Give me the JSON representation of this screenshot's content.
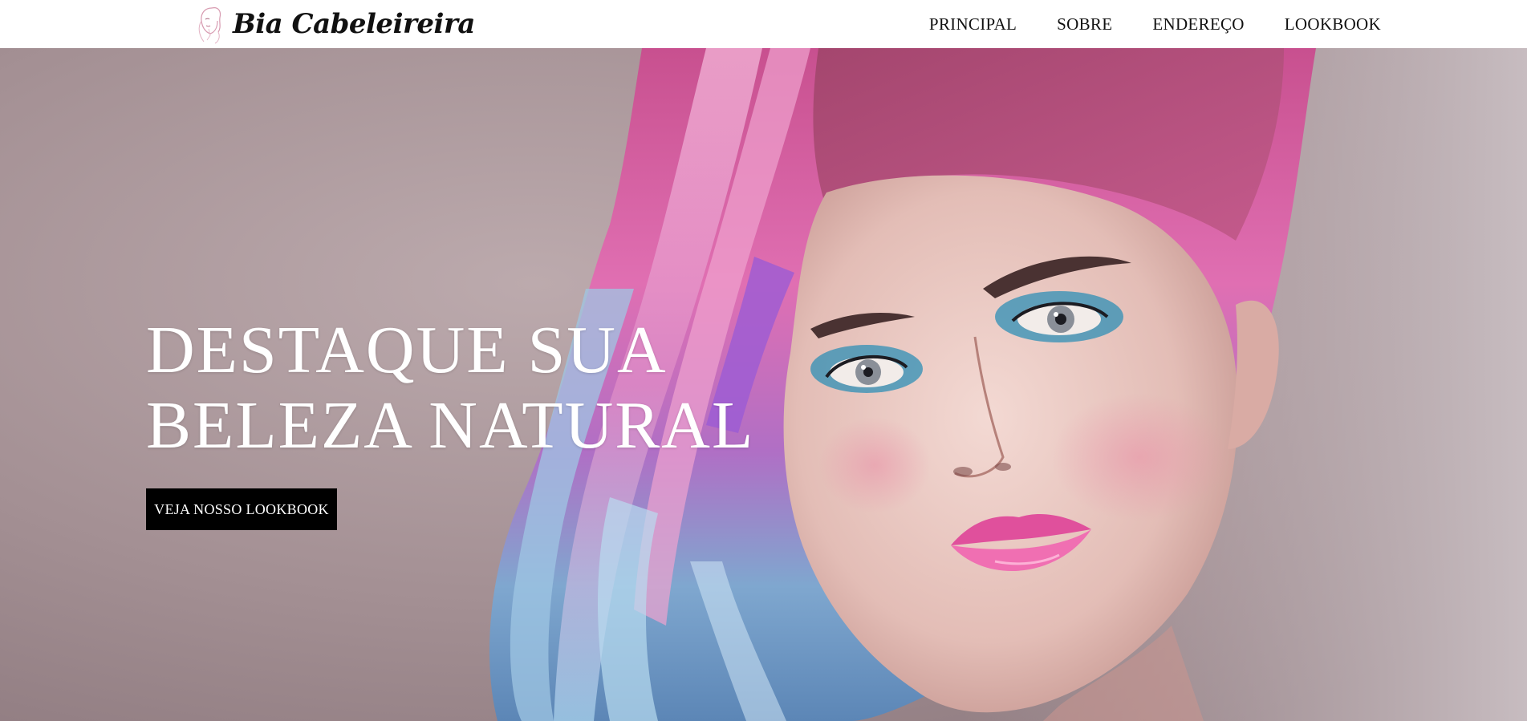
{
  "brand": {
    "name": "Bia Cabeleireira",
    "icon": "woman-face-logo-icon"
  },
  "nav": {
    "items": [
      {
        "label": "PRINCIPAL"
      },
      {
        "label": "SOBRE"
      },
      {
        "label": "ENDEREÇO"
      },
      {
        "label": "LOOKBOOK"
      }
    ]
  },
  "hero": {
    "title_line1": "DESTAQUE SUA",
    "title_line2": "BELEZA NATURAL",
    "button_label": "VEJA NOSSO LOOKBOOK",
    "image": "woman-with-pink-blue-hair-photo"
  },
  "colors": {
    "nav_background": "#ffffff",
    "button_background": "#000000",
    "hero_text": "#ffffff"
  }
}
